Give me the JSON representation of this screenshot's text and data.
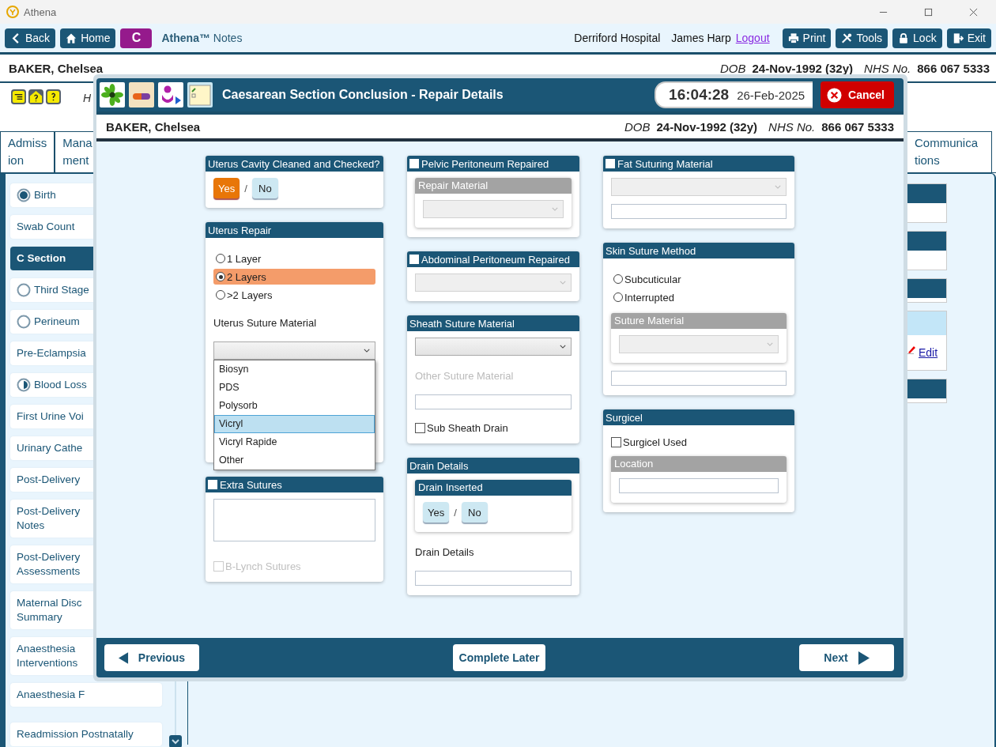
{
  "window": {
    "title": "Athena"
  },
  "toolbar": {
    "back": "Back",
    "home": "Home",
    "badge": "C",
    "app_name": "Athena™",
    "app_suffix": "Notes",
    "hospital": "Derriford Hospital",
    "user": "James Harp",
    "logout": "Logout",
    "actions": [
      {
        "label": "Print",
        "kind": "print"
      },
      {
        "label": "Tools",
        "kind": "tools"
      },
      {
        "label": "Lock",
        "kind": "lock"
      },
      {
        "label": "Exit",
        "kind": "exit"
      }
    ]
  },
  "patient": {
    "name": "BAKER, Chelsea",
    "dob_label": "DOB",
    "dob": "24-Nov-1992 (32y)",
    "nhs_label": "NHS No.",
    "nhs": "866 067 5333"
  },
  "header_text": "H",
  "tabs_left": [
    {
      "lines": [
        "Admiss",
        "ion"
      ]
    },
    {
      "lines": [
        "Mana",
        "ment"
      ]
    }
  ],
  "tabs_right": [
    {
      "lines": [
        "Communica",
        "tions"
      ]
    }
  ],
  "sidebar": {
    "items": [
      {
        "label": "Birth",
        "kind": "complete",
        "selected": false
      },
      {
        "label": "Swab Count",
        "selected": false
      },
      {
        "label": "C Section",
        "selected": true
      },
      {
        "label": "Third Stage",
        "kind": "empty",
        "selected": false
      },
      {
        "label": "Perineum",
        "kind": "empty",
        "selected": false
      },
      {
        "label": "Pre-Eclampsia",
        "selected": false
      },
      {
        "label": "Blood Loss",
        "kind": "partial",
        "selected": false
      },
      {
        "label": "First Urine Voi",
        "selected": false
      },
      {
        "label": "Urinary Cathe",
        "selected": false
      },
      {
        "label": "Post-Delivery",
        "selected": false
      },
      {
        "label": "Post-Delivery Notes",
        "selected": false
      },
      {
        "label": "Post-Delivery Assessments",
        "selected": false
      },
      {
        "label": "Maternal Disc Summary",
        "selected": false
      },
      {
        "label": "Anaesthesia Interventions",
        "selected": false
      },
      {
        "label": "Anaesthesia F",
        "selected": false
      }
    ],
    "footer_item": {
      "label": "Readmission Postnatally",
      "selected": false
    }
  },
  "edit_link": "Edit",
  "modal": {
    "title": "Caesarean Section Conclusion - Repair Details",
    "time": "16:04:28",
    "date": "26-Feb-2025",
    "cancel": "Cancel",
    "patient": {
      "name": "BAKER, Chelsea",
      "dob_label": "DOB",
      "dob": "24-Nov-1992 (32y)",
      "nhs_label": "NHS No.",
      "nhs": "866 067 5333"
    },
    "columns": [
      {
        "cards": [
          {
            "title": "Uterus Cavity Cleaned and Checked?",
            "items": [
              {
                "kind": "yesno",
                "separator": "/",
                "options": [
                  {
                    "label": "Yes",
                    "selected": true
                  },
                  {
                    "label": "No",
                    "selected": false
                  }
                ]
              }
            ]
          },
          {
            "title": "Uterus Repair",
            "items": [
              {
                "kind": "radios",
                "options": [
                  {
                    "label": "1 Layer",
                    "selected": false
                  },
                  {
                    "label": "2 Layers",
                    "selected": true
                  },
                  {
                    "label": ">2 Layers",
                    "selected": false
                  }
                ]
              },
              {
                "kind": "label",
                "text": "Uterus Suture Material",
                "disabled": false
              },
              {
                "kind": "select",
                "disabled": false,
                "open": true,
                "options": [
                  {
                    "label": "Biosyn",
                    "selected": false
                  },
                  {
                    "label": "PDS",
                    "selected": false
                  },
                  {
                    "label": "Polysorb",
                    "selected": false
                  },
                  {
                    "label": "Vicryl",
                    "selected": true
                  },
                  {
                    "label": "Vicryl Rapide",
                    "selected": false
                  },
                  {
                    "label": "Other",
                    "selected": false
                  }
                ]
              }
            ]
          },
          {
            "title": "Extra Sutures",
            "checked": false,
            "items": [
              {
                "kind": "textarea"
              },
              {
                "kind": "checkbox",
                "label": "B-Lynch Sutures",
                "checked": false,
                "disabled": true
              }
            ]
          }
        ]
      },
      {
        "cards": [
          {
            "title": "Pelvic Peritoneum Repaired",
            "checked": false,
            "items": [
              {
                "kind": "subcard",
                "title": "Repair Material",
                "disabled": true,
                "items": [
                  {
                    "kind": "select",
                    "disabled": true
                  }
                ]
              }
            ]
          },
          {
            "title": "Abdominal Peritoneum Repaired",
            "checked": false,
            "items": [
              {
                "kind": "select",
                "disabled": true
              }
            ]
          },
          {
            "title": "Sheath Suture Material",
            "items": [
              {
                "kind": "select",
                "disabled": false
              },
              {
                "kind": "label",
                "text": "Other Suture Material",
                "disabled": true
              },
              {
                "kind": "input"
              },
              {
                "kind": "checkbox",
                "label": "Sub Sheath Drain",
                "checked": false,
                "disabled": false
              }
            ]
          },
          {
            "title": "Drain Details",
            "items": [
              {
                "kind": "subcard",
                "title": "Drain Inserted",
                "disabled": false,
                "items": [
                  {
                    "kind": "yesno",
                    "separator": "/",
                    "options": [
                      {
                        "label": "Yes",
                        "selected": false
                      },
                      {
                        "label": "No",
                        "selected": false
                      }
                    ]
                  }
                ]
              },
              {
                "kind": "label",
                "text": "Drain Details",
                "disabled": false
              },
              {
                "kind": "input"
              }
            ]
          }
        ]
      },
      {
        "cards": [
          {
            "title": "Fat Suturing Material",
            "checked": false,
            "items": [
              {
                "kind": "select",
                "disabled": true
              },
              {
                "kind": "input"
              }
            ]
          },
          {
            "title": "Skin Suture Method",
            "items": [
              {
                "kind": "radios",
                "options": [
                  {
                    "label": "Subcuticular",
                    "selected": false
                  },
                  {
                    "label": "Interrupted",
                    "selected": false
                  }
                ]
              },
              {
                "kind": "subcard",
                "title": "Suture Material",
                "disabled": true,
                "items": [
                  {
                    "kind": "select",
                    "disabled": true
                  }
                ]
              },
              {
                "kind": "input"
              }
            ]
          },
          {
            "title": "Surgicel",
            "items": [
              {
                "kind": "checkbox",
                "label": "Surgicel Used",
                "checked": false,
                "disabled": false
              },
              {
                "kind": "subcard",
                "title": "Location",
                "disabled": true,
                "items": [
                  {
                    "kind": "input"
                  }
                ]
              }
            ]
          }
        ]
      }
    ],
    "footer": {
      "previous": "Previous",
      "complete_later": "Complete Later",
      "next": "Next"
    }
  }
}
